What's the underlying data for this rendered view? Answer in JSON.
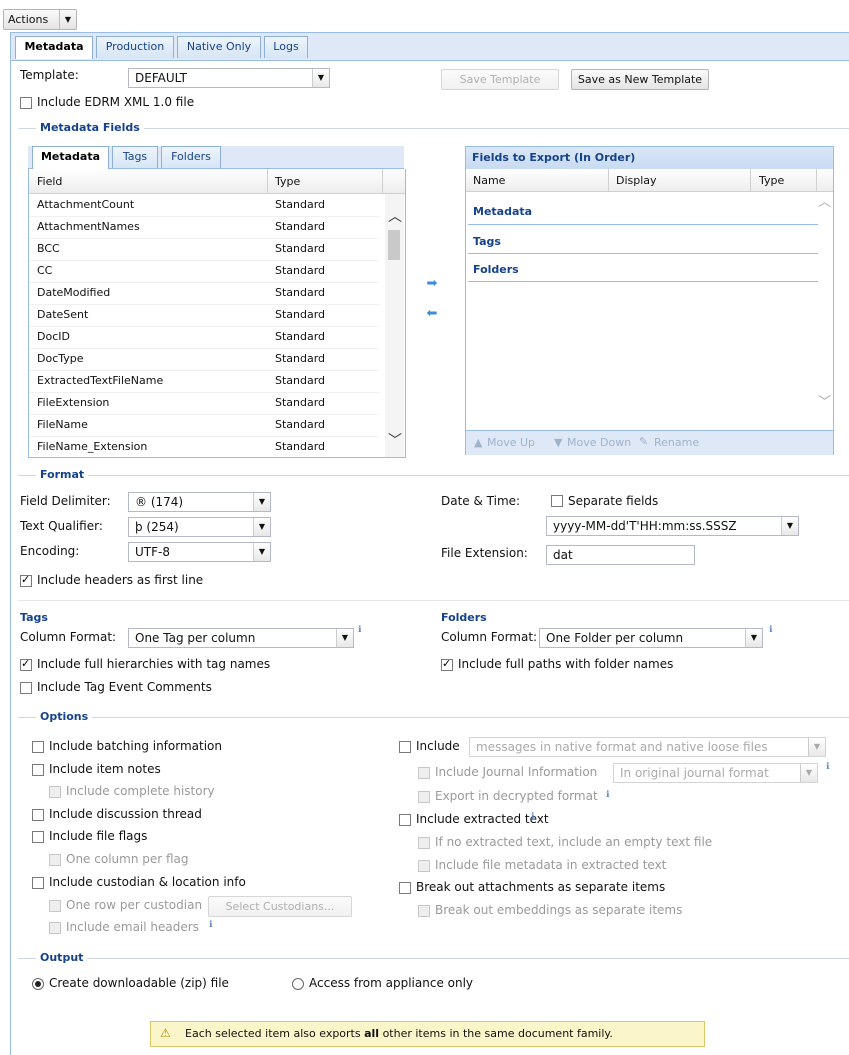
{
  "actions_label": "Actions",
  "main_tabs": [
    "Metadata",
    "Production",
    "Native Only",
    "Logs"
  ],
  "template": {
    "label": "Template:",
    "value": "DEFAULT",
    "save_label": "Save Template",
    "save_new_label": "Save as New Template"
  },
  "edrm_label": "Include EDRM XML 1.0 file",
  "metadata_fields": {
    "section_title": "Metadata Fields",
    "tabs": [
      "Metadata",
      "Tags",
      "Folders"
    ],
    "col_field": "Field",
    "col_type": "Type",
    "rows": [
      {
        "field": "AttachmentCount",
        "type": "Standard"
      },
      {
        "field": "AttachmentNames",
        "type": "Standard"
      },
      {
        "field": "BCC",
        "type": "Standard"
      },
      {
        "field": "CC",
        "type": "Standard"
      },
      {
        "field": "DateModified",
        "type": "Standard"
      },
      {
        "field": "DateSent",
        "type": "Standard"
      },
      {
        "field": "DocID",
        "type": "Standard"
      },
      {
        "field": "DocType",
        "type": "Standard"
      },
      {
        "field": "ExtractedTextFileName",
        "type": "Standard"
      },
      {
        "field": "FileExtension",
        "type": "Standard"
      },
      {
        "field": "FileName",
        "type": "Standard"
      },
      {
        "field": "FileName_Extension",
        "type": "Standard"
      }
    ]
  },
  "export": {
    "title": "Fields to Export (In Order)",
    "col_name": "Name",
    "col_display": "Display",
    "col_type": "Type",
    "groups": [
      "Metadata",
      "Tags",
      "Folders"
    ],
    "move_up": "Move Up",
    "move_down": "Move Down",
    "rename": "Rename"
  },
  "format": {
    "section_title": "Format",
    "field_delim_label": "Field Delimiter:",
    "field_delim_value": "® (174)",
    "text_qual_label": "Text Qualifier:",
    "text_qual_value": "þ (254)",
    "encoding_label": "Encoding:",
    "encoding_value": "UTF-8",
    "headers_label": "Include headers as first line",
    "datetime_label": "Date & Time:",
    "separate_label": "Separate fields",
    "datetime_value": "yyyy-MM-dd'T'HH:mm:ss.SSSZ",
    "file_ext_label": "File Extension:",
    "file_ext_value": "dat"
  },
  "tags": {
    "title": "Tags",
    "col_format_label": "Column Format:",
    "col_format_value": "One Tag per column",
    "hier_label": "Include full hierarchies with tag names",
    "event_label": "Include Tag Event Comments"
  },
  "folders": {
    "title": "Folders",
    "col_format_label": "Column Format:",
    "col_format_value": "One Folder per column",
    "paths_label": "Include full paths with folder names"
  },
  "options": {
    "section_title": "Options",
    "batching": "Include batching information",
    "item_notes": "Include item notes",
    "complete_history": "Include complete history",
    "discussion": "Include discussion thread",
    "file_flags": "Include file flags",
    "one_col_flag": "One column per flag",
    "custodian": "Include custodian & location info",
    "one_row_cust": "One row per custodian",
    "select_cust": "Select Custodians...",
    "email_headers": "Include email headers",
    "include": "Include",
    "include_value": "messages in native format and native loose files",
    "journal": "Include Journal Information",
    "journal_value": "In original journal format",
    "decrypted": "Export in decrypted format",
    "extracted": "Include extracted text",
    "empty_text": "If no extracted text, include an empty text file",
    "file_metadata": "Include file metadata in extracted text",
    "break_attach": "Break out attachments as separate items",
    "break_embed": "Break out embeddings as separate items"
  },
  "output": {
    "section_title": "Output",
    "zip": "Create downloadable (zip) file",
    "appliance": "Access from appliance only"
  },
  "notice": {
    "pre": "Each selected item also exports ",
    "bold": "all",
    "post": " other items in the same document family."
  }
}
